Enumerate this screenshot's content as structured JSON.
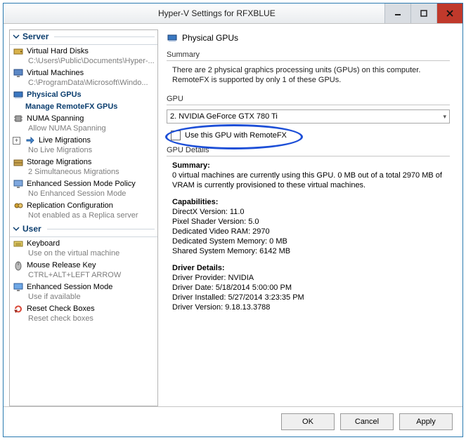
{
  "window": {
    "title": "Hyper-V Settings for RFXBLUE"
  },
  "sidebar": {
    "sections": [
      {
        "header": "Server",
        "items": [
          {
            "label": "Virtual Hard Disks",
            "sub": "C:\\Users\\Public\\Documents\\Hyper-..."
          },
          {
            "label": "Virtual Machines",
            "sub": "C:\\ProgramData\\Microsoft\\Windo..."
          },
          {
            "label": "Physical GPUs",
            "sub": "",
            "selected": true,
            "child": {
              "label": "Manage RemoteFX GPUs"
            }
          },
          {
            "label": "NUMA Spanning",
            "sub": "Allow NUMA Spanning"
          },
          {
            "label": "Live Migrations",
            "sub": "No Live Migrations",
            "expandable": true
          },
          {
            "label": "Storage Migrations",
            "sub": "2 Simultaneous Migrations"
          },
          {
            "label": "Enhanced Session Mode Policy",
            "sub": "No Enhanced Session Mode"
          },
          {
            "label": "Replication Configuration",
            "sub": "Not enabled as a Replica server"
          }
        ]
      },
      {
        "header": "User",
        "items": [
          {
            "label": "Keyboard",
            "sub": "Use on the virtual machine"
          },
          {
            "label": "Mouse Release Key",
            "sub": "CTRL+ALT+LEFT ARROW"
          },
          {
            "label": "Enhanced Session Mode",
            "sub": "Use if available"
          },
          {
            "label": "Reset Check Boxes",
            "sub": "Reset check boxes"
          }
        ]
      }
    ]
  },
  "main": {
    "header": "Physical GPUs",
    "summary_label": "Summary",
    "summary_text": "There are 2 physical graphics processing units (GPUs) on this computer. RemoteFX is supported by only 1 of these GPUs.",
    "gpu_label": "GPU",
    "gpu_selected": "2. NVIDIA GeForce GTX 780 Ti",
    "checkbox_label": "Use this GPU with RemoteFX",
    "details_label": "GPU Details",
    "details": {
      "summary_hdr": "Summary:",
      "summary_body": "0 virtual machines are currently using this GPU. 0 MB out of a total 2970 MB of VRAM is currently provisioned to these virtual machines.",
      "caps_hdr": "Capabilities:",
      "caps_lines": [
        "DirectX Version: 11.0",
        "Pixel Shader Version: 5.0",
        "Dedicated Video RAM: 2970",
        "Dedicated System Memory: 0 MB",
        "Shared System Memory: 6142 MB"
      ],
      "drv_hdr": "Driver Details:",
      "drv_lines": [
        "Driver Provider: NVIDIA",
        "Driver Date: 5/18/2014 5:00:00 PM",
        "Driver Installed: 5/27/2014 3:23:35 PM",
        "Driver Version: 9.18.13.3788"
      ]
    }
  },
  "buttons": {
    "ok": "OK",
    "cancel": "Cancel",
    "apply": "Apply"
  }
}
